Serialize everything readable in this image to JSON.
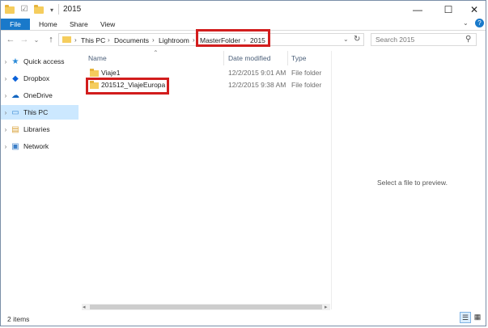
{
  "window": {
    "title": "2015",
    "controls": {
      "minimize": "—",
      "maximize": "☐",
      "close": "✕"
    }
  },
  "ribbon": {
    "file_label": "File",
    "tabs": [
      "Home",
      "Share",
      "View"
    ],
    "expand_icon": "chevron-down-icon"
  },
  "address": {
    "crumbs": [
      "This PC",
      "Documents",
      "Lightroom",
      "MasterFolder",
      "2015"
    ],
    "separator": "›",
    "refresh_icon": "refresh-icon",
    "search_placeholder": "Search 2015"
  },
  "nav_pane": {
    "items": [
      {
        "label": "Quick access",
        "icon": "star-icon"
      },
      {
        "label": "Dropbox",
        "icon": "dropbox-icon"
      },
      {
        "label": "OneDrive",
        "icon": "cloud-icon"
      },
      {
        "label": "This PC",
        "icon": "computer-icon"
      },
      {
        "label": "Libraries",
        "icon": "libraries-icon"
      },
      {
        "label": "Network",
        "icon": "network-icon"
      }
    ],
    "selected": "This PC"
  },
  "file_list": {
    "columns": [
      "Name",
      "Date modified",
      "Type"
    ],
    "rows": [
      {
        "name": "Viaje1",
        "date": "12/2/2015 9:01 AM",
        "type": "File folder"
      },
      {
        "name": "201512_ViajeEuropa",
        "date": "12/2/2015 9:38 AM",
        "type": "File folder"
      }
    ]
  },
  "preview": {
    "message": "Select a file to preview."
  },
  "status": {
    "count": "2 items"
  },
  "colors": {
    "accent": "#1979ca",
    "highlight": "#d21d1d",
    "selected_bg": "#cce8ff",
    "folder": "#f5cd5d"
  }
}
